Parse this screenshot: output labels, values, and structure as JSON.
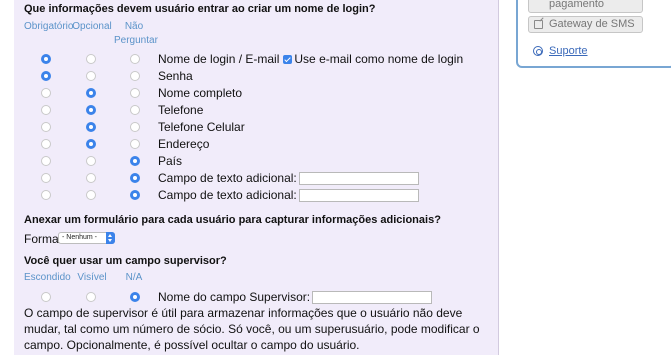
{
  "login_fields": {
    "question": "Que informações devem usuário entrar ao criar um nome de login?",
    "col_required": "Obrigatório",
    "col_optional": "Opcional",
    "col_not_asked_1": "Não",
    "col_not_asked_2": "Perguntar",
    "rows": [
      {
        "label": "Nome de login / E-mail",
        "choice": "required",
        "checkbox_label": "Use e-mail como nome de login",
        "checkbox_checked": true
      },
      {
        "label": "Senha",
        "choice": "required"
      },
      {
        "label": "Nome completo",
        "choice": "optional"
      },
      {
        "label": "Telefone",
        "choice": "optional"
      },
      {
        "label": "Telefone Celular",
        "choice": "optional"
      },
      {
        "label": "Endereço",
        "choice": "optional"
      },
      {
        "label": "País",
        "choice": "not_asked"
      },
      {
        "label": "Campo de texto adicional:",
        "choice": "not_asked",
        "text_value": ""
      },
      {
        "label": "Campo de texto adicional:",
        "choice": "not_asked",
        "text_value": ""
      }
    ]
  },
  "form_attach": {
    "question": "Anexar um formulário para cada usuário para capturar informações adicionais?",
    "form_label": "Forma:",
    "form_selected": "- Nenhum -"
  },
  "supervisor": {
    "question": "Você quer usar um campo supervisor?",
    "col_hidden": "Escondido",
    "col_visible": "Visível",
    "col_na": "N/A",
    "choice": "na",
    "field_label": "Nome do campo Supervisor:",
    "field_value": "",
    "description": "O campo de supervisor é útil para armazenar informações que o usuário não deve mudar, tal como um número de sócio. Só você, ou um superusuário, pode modificar o campo. Opcionalmente, é possível ocultar o campo do usuário."
  },
  "sidebar": {
    "payment_label": "pagamento",
    "sms_label": "Gateway de SMS",
    "support_label": "Suporte"
  },
  "colors": {
    "accent": "#3b83ea",
    "panel_bg": "#f1ecfa",
    "link": "#3a69b9",
    "header_text": "#5b93c9"
  }
}
